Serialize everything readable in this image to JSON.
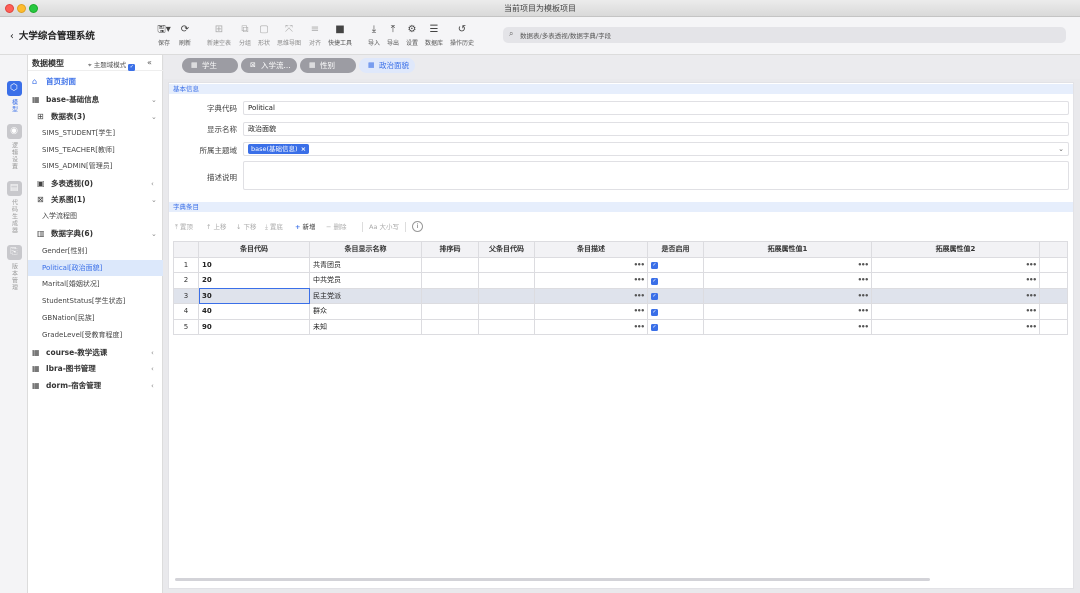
{
  "window": {
    "title": "当前项目为模板项目"
  },
  "app": {
    "title": "大学综合管理系统"
  },
  "toolbar": {
    "items": [
      {
        "label": "保存",
        "icon": "save-icon",
        "glyph": "🖫▾"
      },
      {
        "label": "刷新",
        "icon": "refresh-icon",
        "glyph": "⟳"
      },
      {
        "label": "新建空表",
        "icon": "new-table-icon",
        "glyph": "⊞"
      },
      {
        "label": "分组",
        "icon": "group-icon",
        "glyph": "⧉"
      },
      {
        "label": "形状",
        "icon": "shape-icon",
        "glyph": "▢"
      },
      {
        "label": "思维导图",
        "icon": "mindmap-icon",
        "glyph": "⤧"
      },
      {
        "label": "对齐",
        "icon": "align-icon",
        "glyph": "≡"
      },
      {
        "label": "快捷工具",
        "icon": "toolbox-icon",
        "glyph": "■"
      },
      {
        "label": "导入",
        "icon": "import-icon",
        "glyph": "⤓"
      },
      {
        "label": "导出",
        "icon": "export-icon",
        "glyph": "⤒"
      },
      {
        "label": "设置",
        "icon": "settings-icon",
        "glyph": "⚙"
      },
      {
        "label": "数据库",
        "icon": "database-icon",
        "glyph": "☰"
      },
      {
        "label": "操作历史",
        "icon": "history-icon",
        "glyph": "↺"
      }
    ],
    "search_placeholder": "数据表/多表透视/数据字典/字段"
  },
  "rail": {
    "items": [
      {
        "label": "模型",
        "icon": "model-icon",
        "glyph": "⬡"
      },
      {
        "label": "逻辑设置",
        "icon": "logic-icon",
        "glyph": "◉"
      },
      {
        "label": "代码生成器",
        "icon": "code-generator-icon",
        "glyph": "▤"
      },
      {
        "label": "版本管理",
        "icon": "version-icon",
        "glyph": "⎘"
      }
    ]
  },
  "sidebar": {
    "title": "数据模型",
    "mode_label": "主题域模式",
    "mode_checked": "✓",
    "collapse_glyph": "«",
    "tree": [
      {
        "text": "首页封面",
        "icon": "home-icon",
        "glyph": "⌂",
        "caret": ""
      },
      {
        "text": "base-基础信息",
        "icon": "grid-icon",
        "glyph": "▦",
        "caret": "⌄"
      },
      {
        "text": "数据表(3)",
        "icon": "table-icon",
        "glyph": "⊞",
        "caret": "⌄"
      },
      {
        "text": "SIMS_STUDENT[学生]",
        "icon": "",
        "glyph": "",
        "caret": ""
      },
      {
        "text": "SIMS_TEACHER[教师]",
        "icon": "",
        "glyph": "",
        "caret": ""
      },
      {
        "text": "SIMS_ADMIN[管理员]",
        "icon": "",
        "glyph": "",
        "caret": ""
      },
      {
        "text": "多表透视(0)",
        "icon": "pivot-icon",
        "glyph": "▣",
        "caret": "‹"
      },
      {
        "text": "关系图(1)",
        "icon": "relation-icon",
        "glyph": "⊠",
        "caret": "⌄"
      },
      {
        "text": "入学流程图",
        "icon": "",
        "glyph": "",
        "caret": ""
      },
      {
        "text": "数据字典(6)",
        "icon": "dictionary-icon",
        "glyph": "▥",
        "caret": "⌄"
      },
      {
        "text": "Gender[性别]",
        "icon": "",
        "glyph": "",
        "caret": ""
      },
      {
        "text": "Political[政治面貌]",
        "icon": "",
        "glyph": "",
        "caret": ""
      },
      {
        "text": "Marital[婚姻状况]",
        "icon": "",
        "glyph": "",
        "caret": ""
      },
      {
        "text": "StudentStatus[学生状态]",
        "icon": "",
        "glyph": "",
        "caret": ""
      },
      {
        "text": "GBNation[民族]",
        "icon": "",
        "glyph": "",
        "caret": ""
      },
      {
        "text": "GradeLevel[受教育程度]",
        "icon": "",
        "glyph": "",
        "caret": ""
      },
      {
        "text": "course-教学选课",
        "icon": "grid-icon",
        "glyph": "▦",
        "caret": "‹"
      },
      {
        "text": "lbra-图书管理",
        "icon": "grid-icon",
        "glyph": "▦",
        "caret": "‹"
      },
      {
        "text": "dorm-宿舍管理",
        "icon": "grid-icon",
        "glyph": "▦",
        "caret": "‹"
      }
    ]
  },
  "tabs": [
    {
      "label": "学生",
      "glyph": "▦"
    },
    {
      "label": "入学流...",
      "glyph": "⊠"
    },
    {
      "label": "性别",
      "glyph": "▦"
    },
    {
      "label": "政治面貌",
      "glyph": "▦"
    }
  ],
  "basic_info": {
    "section_title": "基本信息",
    "code_label": "字典代码",
    "code_value": "Political",
    "name_label": "显示名称",
    "name_value": "政治面貌",
    "domain_label": "所属主题域",
    "domain_tag": "base(基础信息)",
    "domain_tag_remove": "×",
    "domain_chevron": "⌄",
    "desc_label": "描述说明",
    "desc_value": ""
  },
  "entries": {
    "section_title": "字典条目",
    "toolbar": {
      "top": "置顶",
      "up": "上移",
      "down": "下移",
      "bottom": "置底",
      "add": "新增",
      "delete": "删除",
      "case": "大小写",
      "info": "i"
    },
    "columns": [
      "",
      "条目代码",
      "条目显示名称",
      "排序码",
      "父条目代码",
      "条目描述",
      "是否启用",
      "拓展属性值1",
      "拓展属性值2",
      ""
    ],
    "rows": [
      {
        "n": "1",
        "code": "10",
        "name": "共青团员",
        "sort": "",
        "parent": "",
        "desc": "",
        "enabled": "✓",
        "ext1": "",
        "ext2": ""
      },
      {
        "n": "2",
        "code": "20",
        "name": "中共党员",
        "sort": "",
        "parent": "",
        "desc": "",
        "enabled": "✓",
        "ext1": "",
        "ext2": ""
      },
      {
        "n": "3",
        "code": "30",
        "name": "民主党派",
        "sort": "",
        "parent": "",
        "desc": "",
        "enabled": "✓",
        "ext1": "",
        "ext2": ""
      },
      {
        "n": "4",
        "code": "40",
        "name": "群众",
        "sort": "",
        "parent": "",
        "desc": "",
        "enabled": "✓",
        "ext1": "",
        "ext2": ""
      },
      {
        "n": "5",
        "code": "90",
        "name": "未知",
        "sort": "",
        "parent": "",
        "desc": "",
        "enabled": "✓",
        "ext1": "",
        "ext2": ""
      }
    ],
    "dots": "•••"
  },
  "colors": {
    "accent": "#3a6fe8",
    "selected_row": "#dfe3ec",
    "section_bg": "#e6eefc"
  }
}
